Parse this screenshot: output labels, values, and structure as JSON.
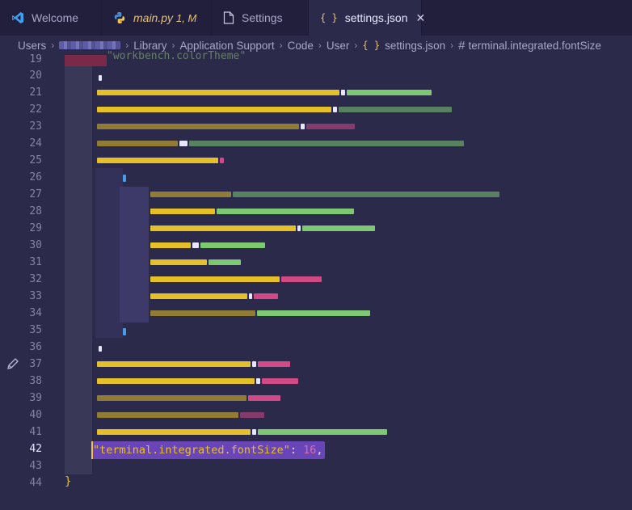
{
  "tabs": [
    {
      "label": "Welcome",
      "icon": "vscode-icon",
      "active": false
    },
    {
      "label": "main.py",
      "status": "1, M",
      "icon": "python-icon",
      "active": false
    },
    {
      "label": "Settings",
      "icon": "file-icon",
      "active": false
    },
    {
      "label": "settings.json",
      "icon": "json-braces-icon",
      "active": true
    }
  ],
  "breadcrumb": {
    "root": "Users",
    "library": "Library",
    "app_support": "Application Support",
    "code": "Code",
    "user": "User",
    "file": "settings.json",
    "symbol": "terminal.integrated.fontSize"
  },
  "editor": {
    "line_numbers": [
      "19",
      "20",
      "21",
      "22",
      "23",
      "24",
      "25",
      "26",
      "27",
      "28",
      "29",
      "30",
      "31",
      "32",
      "33",
      "34",
      "35",
      "36",
      "37",
      "38",
      "39",
      "40",
      "41",
      "42",
      "43",
      "44"
    ],
    "current_line": "42",
    "top_fragment": "\"workbench.colorTheme\"",
    "highlighted": {
      "key": "\"terminal.integrated.fontSize\"",
      "colon": ": ",
      "value": "16",
      "comma": ","
    },
    "closing_brace": "}"
  },
  "colors": {
    "background": "#2b2a4a",
    "tabbar": "#221f3d",
    "string_key": "#e5c028",
    "number": "#e06c9f",
    "selection": "#6a45b8"
  }
}
